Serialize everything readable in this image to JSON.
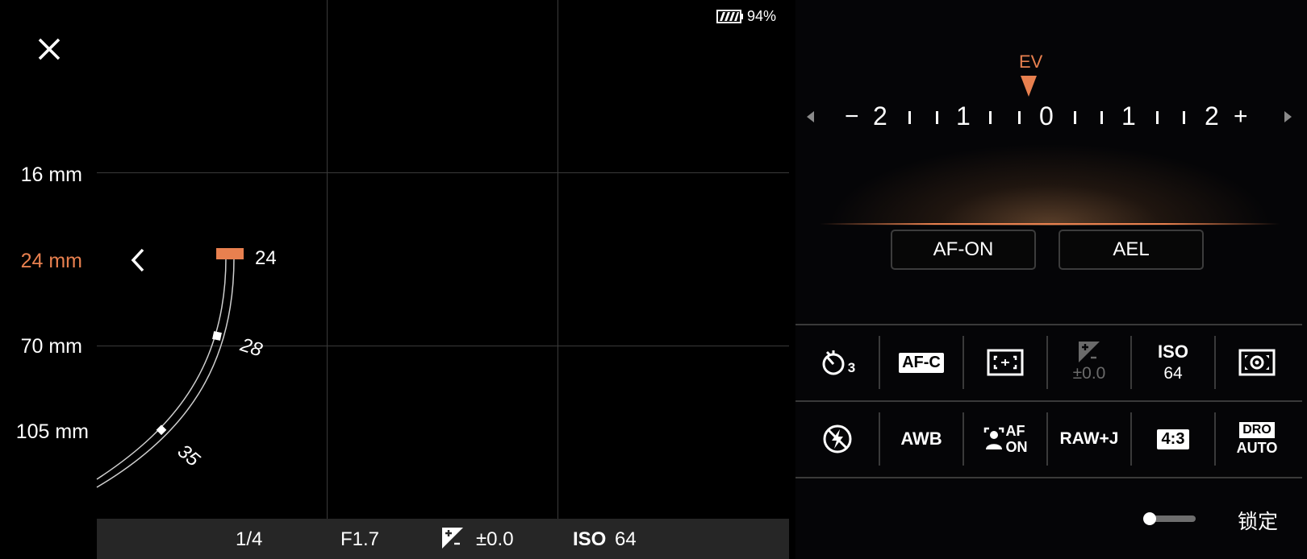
{
  "status": {
    "battery_percent": "94%"
  },
  "viewfinder": {
    "focal_lengths": [
      {
        "label": "16 mm",
        "active": false
      },
      {
        "label": "24 mm",
        "active": true
      },
      {
        "label": "70 mm",
        "active": false
      },
      {
        "label": "105 mm",
        "active": false
      }
    ],
    "zoom_current": "24",
    "zoom_ticks": [
      "28",
      "35"
    ]
  },
  "exposure_bar": {
    "shutter": "1/4",
    "aperture": "F1.7",
    "ev": "±0.0",
    "iso_label": "ISO",
    "iso_value": "64"
  },
  "ev_scale": {
    "label": "EV",
    "minus": "−",
    "plus": "+",
    "numbers": [
      "2",
      "1",
      "0",
      "1",
      "2"
    ],
    "accent_color": "#e8804f"
  },
  "buttons": {
    "af_on": "AF-ON",
    "ael": "AEL"
  },
  "settings_row1": {
    "drive_sub": "3",
    "focus_mode": "AF-C",
    "ev_value": "±0.0",
    "iso_label": "ISO",
    "iso_value": "64"
  },
  "settings_row2": {
    "white_balance": "AWB",
    "face_af_line1": "AF",
    "face_af_line2": "ON",
    "file_format": "RAW+J",
    "aspect": "4:3",
    "dro_line1": "DRO",
    "dro_line2": "AUTO"
  },
  "lock": {
    "label": "锁定"
  }
}
